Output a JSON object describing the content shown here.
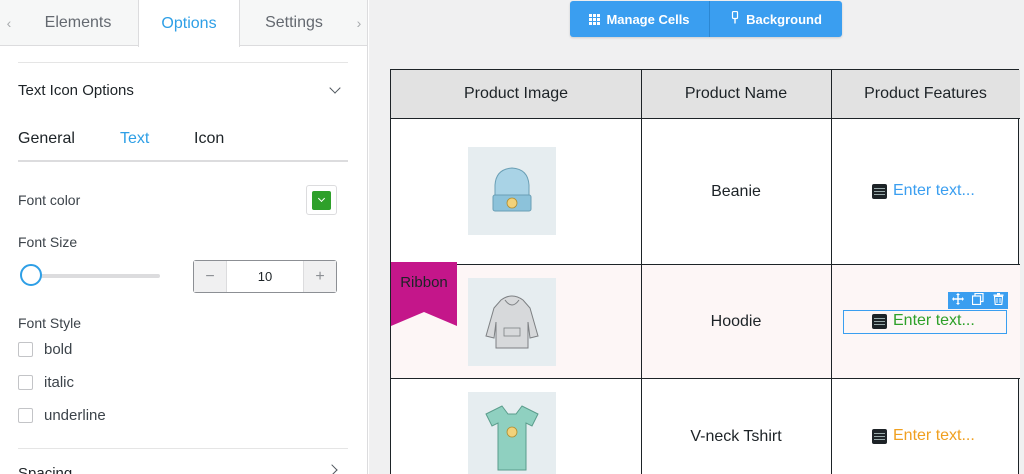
{
  "panel": {
    "tabs": [
      {
        "label": "Elements"
      },
      {
        "label": "Options"
      },
      {
        "label": "Settings"
      }
    ],
    "active_tab": "Options",
    "section_title": "Text Icon Options",
    "subtabs": [
      {
        "label": "General"
      },
      {
        "label": "Text"
      },
      {
        "label": "Icon"
      }
    ],
    "active_subtab": "Text",
    "font_color_label": "Font color",
    "font_color_value": "#2ea02a",
    "font_size_label": "Font Size",
    "font_size_value": "10",
    "stepper_minus": "−",
    "stepper_plus": "+",
    "font_style_label": "Font Style",
    "font_style_options": [
      {
        "label": "bold",
        "checked": false
      },
      {
        "label": "italic",
        "checked": false
      },
      {
        "label": "underline",
        "checked": false
      }
    ],
    "next_section_title": "Spacing"
  },
  "toolbar": {
    "manage_cells": "Manage Cells",
    "background": "Background"
  },
  "table": {
    "headers": [
      "Product Image",
      "Product Name",
      "Product Features"
    ],
    "rows": [
      {
        "image": "beanie-image",
        "name": "Beanie",
        "feature": "Enter text...",
        "feature_color": "#3a9ef0"
      },
      {
        "image": "hoodie-image",
        "name": "Hoodie",
        "feature": "Enter text...",
        "feature_color": "#2ea02a"
      },
      {
        "image": "tshirt-image",
        "name": "V-neck Tshirt",
        "feature": "Enter text...",
        "feature_color": "#f0a020"
      }
    ],
    "ribbon_label": "Ribbon",
    "ribbon_color": "#c4168a"
  }
}
